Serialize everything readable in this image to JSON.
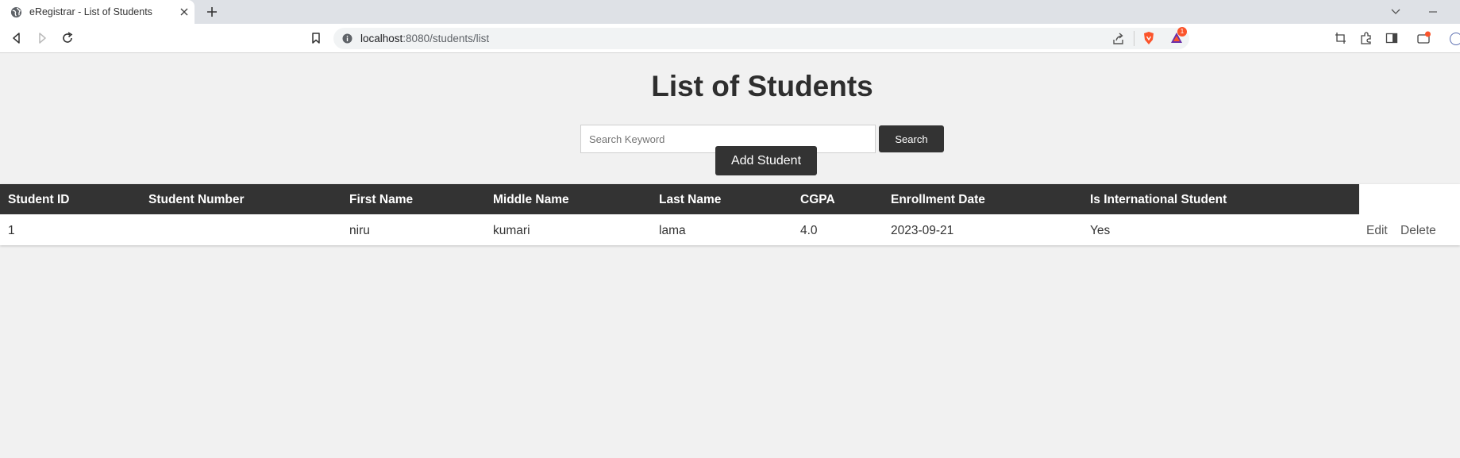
{
  "browser": {
    "tab_title": "eRegistrar - List of Students",
    "url_host": "localhost",
    "url_rest": ":8080/students/list",
    "notification_count": "1"
  },
  "page": {
    "title": "List of Students",
    "search": {
      "placeholder": "Search Keyword",
      "value": "",
      "button_label": "Search"
    },
    "add_button_label": "Add Student"
  },
  "table": {
    "columns": [
      "Student ID",
      "Student Number",
      "First Name",
      "Middle Name",
      "Last Name",
      "CGPA",
      "Enrollment Date",
      "Is International Student"
    ],
    "rows": [
      {
        "cells": [
          "1",
          "",
          "niru",
          "kumari",
          "lama",
          "4.0",
          "2023-09-21",
          "Yes"
        ],
        "edit_label": "Edit",
        "delete_label": "Delete"
      }
    ]
  },
  "colors": {
    "dark": "#333333",
    "page_bg": "#f1f1f1",
    "brave_orange": "#fb542b"
  },
  "icons": [
    "globe-icon",
    "close-icon",
    "plus-icon",
    "chevron-down-icon",
    "minimize-icon",
    "back-icon",
    "forward-icon",
    "reload-icon",
    "bookmark-icon",
    "info-icon",
    "share-icon",
    "brave-shield-icon",
    "brave-rewards-icon",
    "screenshot-icon",
    "extensions-icon",
    "sidebar-icon",
    "wallet-icon"
  ]
}
